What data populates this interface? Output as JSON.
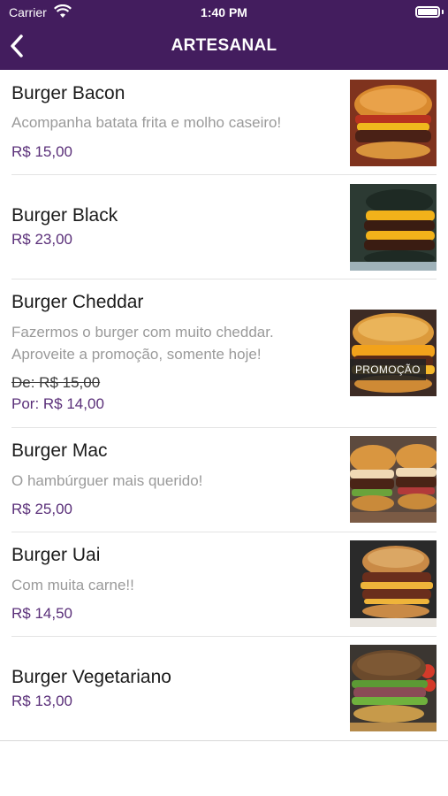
{
  "status": {
    "carrier": "Carrier",
    "time": "1:40 PM"
  },
  "header": {
    "title": "ARTESANAL",
    "back_icon": "chevron-left-icon"
  },
  "colors": {
    "primary": "#431d5e",
    "price": "#5a2f79",
    "muted": "#9a9a9a"
  },
  "items": [
    {
      "name": "Burger Bacon",
      "description": "Acompanha batata frita e molho caseiro!",
      "price": "R$ 15,00"
    },
    {
      "name": "Burger Black",
      "price": "R$ 23,00"
    },
    {
      "name": "Burger Cheddar",
      "description_1": "Fazermos o burger com muito cheddar.",
      "description_2": "Aproveite a promoção, somente hoje!",
      "old_price": "De: R$ 15,00",
      "new_price": "Por: R$ 14,00",
      "badge": "PROMOÇÃO"
    },
    {
      "name": "Burger Mac",
      "description": "O hambúrguer mais querido!",
      "price": "R$ 25,00"
    },
    {
      "name": "Burger Uai",
      "description": "Com muita carne!!",
      "price": "R$ 14,50"
    },
    {
      "name": "Burger Vegetariano",
      "price": "R$ 13,00"
    }
  ]
}
